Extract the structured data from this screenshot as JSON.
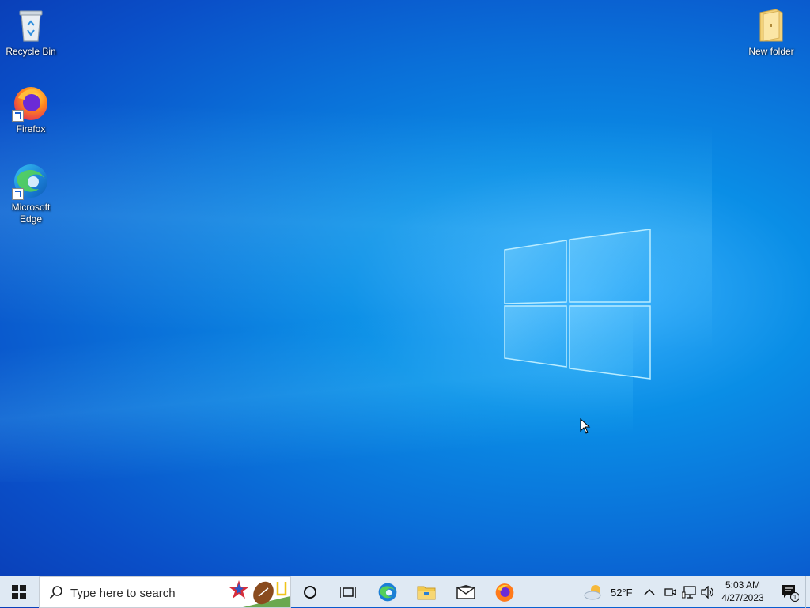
{
  "desktop": {
    "icons": [
      {
        "label": "Recycle Bin",
        "icon": "recycle-bin-icon"
      },
      {
        "label": "Firefox",
        "icon": "firefox-icon"
      },
      {
        "label": "Microsoft Edge",
        "icon": "edge-icon"
      },
      {
        "label": "New folder",
        "icon": "folder-icon"
      }
    ]
  },
  "taskbar": {
    "search": {
      "placeholder": "Type here to search"
    },
    "pinned": [
      "cortana-icon",
      "task-view-icon",
      "edge-icon",
      "file-explorer-icon",
      "mail-icon",
      "firefox-icon"
    ],
    "weather": {
      "temp": "52°F",
      "icon": "partly-cloudy-icon"
    },
    "tray_icons": [
      "chevron-up-icon",
      "meet-now-icon",
      "network-icon",
      "volume-icon"
    ],
    "clock": {
      "time": "5:03 AM",
      "date": "4/27/2023"
    },
    "notifications": {
      "count": "1"
    }
  },
  "colors": {
    "accent": "#0078d7",
    "taskbar_bg": "#dfe9f3"
  }
}
